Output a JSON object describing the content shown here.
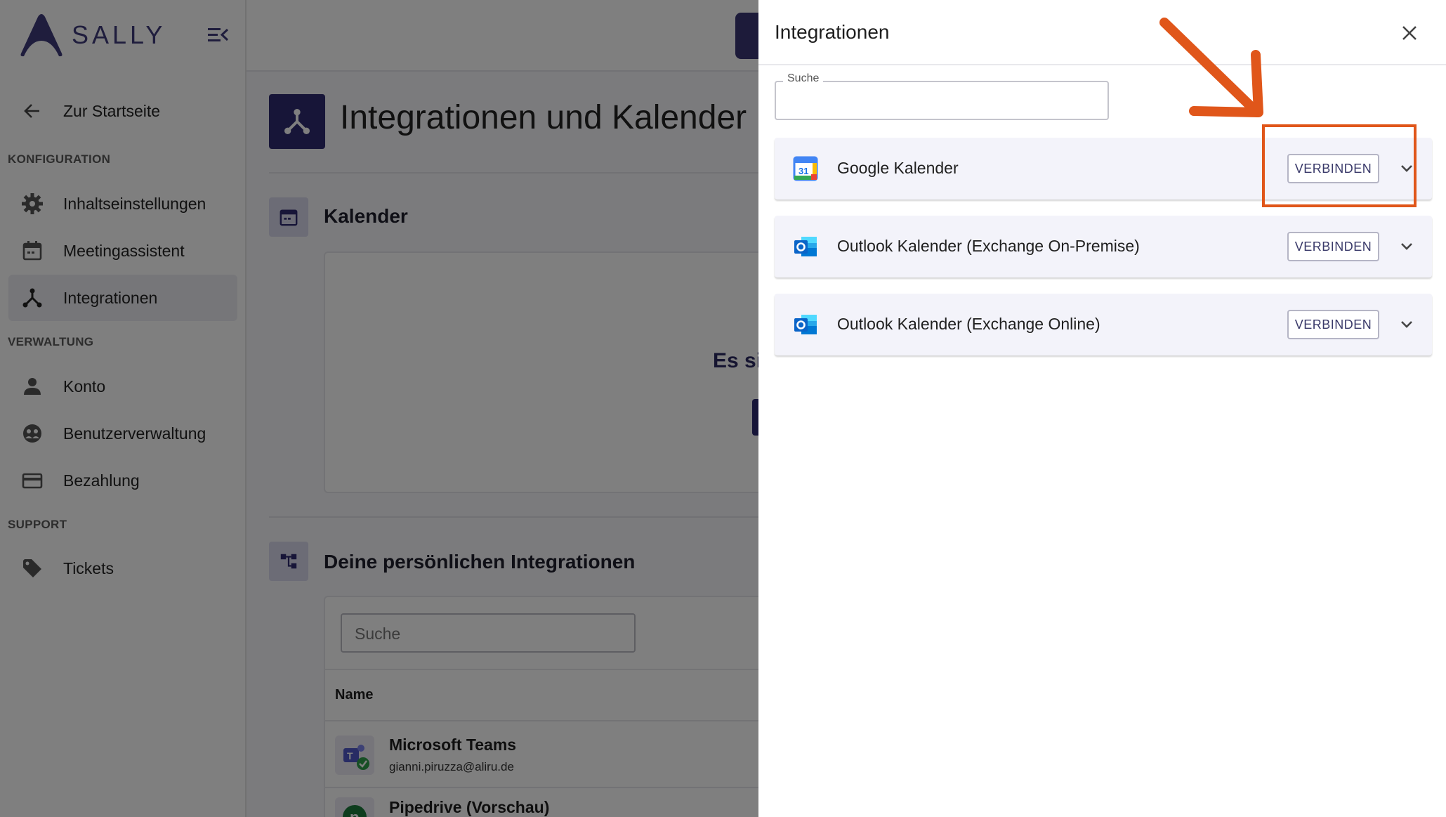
{
  "brand": {
    "name": "SALLY"
  },
  "sidebar": {
    "back_label": "Zur Startseite",
    "sections": [
      {
        "title": "KONFIGURATION"
      },
      {
        "title": "VERWALTUNG"
      },
      {
        "title": "SUPPORT"
      }
    ],
    "items": [
      {
        "label": "Inhaltseinstellungen",
        "icon": "gear-icon"
      },
      {
        "label": "Meetingassistent",
        "icon": "calendar-icon"
      },
      {
        "label": "Integrationen",
        "icon": "integrations-icon",
        "active": true
      },
      {
        "label": "Konto",
        "icon": "person-icon"
      },
      {
        "label": "Benutzerverwaltung",
        "icon": "users-icon"
      },
      {
        "label": "Bezahlung",
        "icon": "credit-card-icon"
      },
      {
        "label": "Tickets",
        "icon": "tag-icon"
      }
    ]
  },
  "main": {
    "page_title": "Integrationen und Kalender",
    "calendar_section_title": "Kalender",
    "calendar_empty_text": "Es si",
    "personal_section_title": "Deine persönlichen Integrationen",
    "search_placeholder": "Suche",
    "table_header_name": "Name",
    "rows": [
      {
        "name": "Microsoft Teams",
        "email": "gianni.piruzza@aliru.de"
      },
      {
        "name": "Pipedrive (Vorschau)"
      }
    ]
  },
  "drawer": {
    "title": "Integrationen",
    "search_label": "Suche",
    "search_value": "",
    "items": [
      {
        "name": "Google Kalender",
        "button": "VERBINDEN",
        "icon": "google-calendar-icon"
      },
      {
        "name": "Outlook Kalender (Exchange On-Premise)",
        "button": "VERBINDEN",
        "icon": "outlook-icon"
      },
      {
        "name": "Outlook Kalender (Exchange Online)",
        "button": "VERBINDEN",
        "icon": "outlook-icon"
      }
    ]
  },
  "colors": {
    "brand": "#3e3a7a",
    "annotation": "#e0561a",
    "google_blue": "#4285f4",
    "outlook_blue": "#0a64c8"
  }
}
